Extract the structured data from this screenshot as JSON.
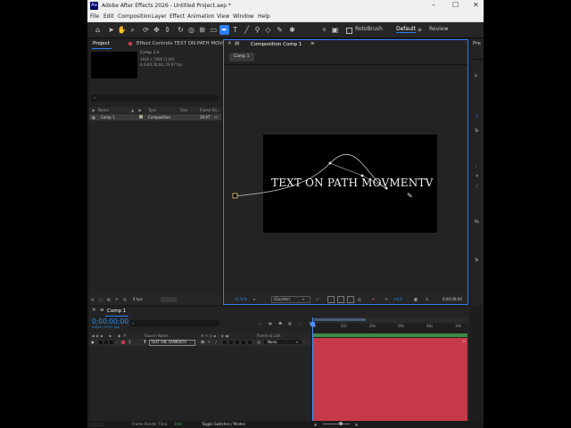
{
  "titlebar": {
    "logo": "Ae",
    "title": "Adobe After Effects 2026 - Untitled Project.aep *",
    "minimize": "–",
    "maximize": "☐",
    "close": "✕"
  },
  "menu": [
    "File",
    "Edit",
    "Composition",
    "Layer",
    "Effect",
    "Animation",
    "View",
    "Window",
    "Help"
  ],
  "toolbar": {
    "rotobrush_label": "RotoBrush",
    "workspaces": [
      "Default",
      "Review"
    ],
    "active_workspace": "Default",
    "tool_icons": [
      "home-icon",
      "selection-arrow-icon",
      "hand-icon",
      "zoom-icon",
      "orbit-icon",
      "move-icon",
      "dolly-icon",
      "rotate-icon",
      "camera-icon",
      "pan-behind-icon",
      "rectangle-tool-icon",
      "pen-tool-icon",
      "type-tool-icon",
      "brush-tool-icon",
      "clone-stamp-icon",
      "eraser-icon",
      "roto-brush-icon",
      "puppet-pin-icon"
    ]
  },
  "project_panel": {
    "tab_project": "Project",
    "tab_effect_controls": "Effect Controls TEXT ON PATH MOVM",
    "selected_item": "Comp 1",
    "item_info": [
      "1920 x 1080 (1.00)",
      "Δ 0;00;30;00, 29.97 fps"
    ],
    "search_placeholder": "",
    "columns": [
      "Name",
      "Type",
      "Size",
      "Frame Ra..."
    ],
    "rows": [
      {
        "name": "Comp 1",
        "type": "Composition",
        "size": "",
        "fps": "29.97"
      }
    ],
    "bpc": "8 bpc"
  },
  "comp_panel": {
    "tab_label": "Composition Comp 1",
    "breadcrumb": "Comp 1",
    "text_on_path": "TEXT ON PATH MOVMENTV",
    "zoom": "21.9 %",
    "resolution": "(Quarter)",
    "exposure": "+0.0",
    "timecode": "0;00;00;00"
  },
  "timeline": {
    "tab_label": "Comp 1",
    "timecode": "0;00;00;00",
    "timecode_sub": "00000 (29.97 fps)",
    "search_placeholder": "",
    "ruler_labels": [
      "0s",
      "02s",
      "04s",
      "06s",
      "08s",
      "10s"
    ],
    "col_source_name": "Source Name",
    "col_parent": "Parent & Link",
    "layer_number": "1",
    "layer_name": "TEXT ON. OVMENTV",
    "parent_value": "None",
    "bar_color": "#c5394a",
    "bar_top_color": "#3d8a47"
  },
  "statusbar": {
    "render_label": "Frame Render Time:",
    "render_value": "1ms",
    "toggle_label": "Toggle Switches / Modes"
  },
  "right_panel": {
    "tab_label": "Pre",
    "letters": [
      "Li",
      "3",
      "Te",
      "Pa",
      "Te"
    ]
  },
  "colors": {
    "accent": "#2d7ef7",
    "panel_bg": "#232323",
    "timecode_blue": "#2d8ceb",
    "timeline_bar": "#c5394a"
  }
}
